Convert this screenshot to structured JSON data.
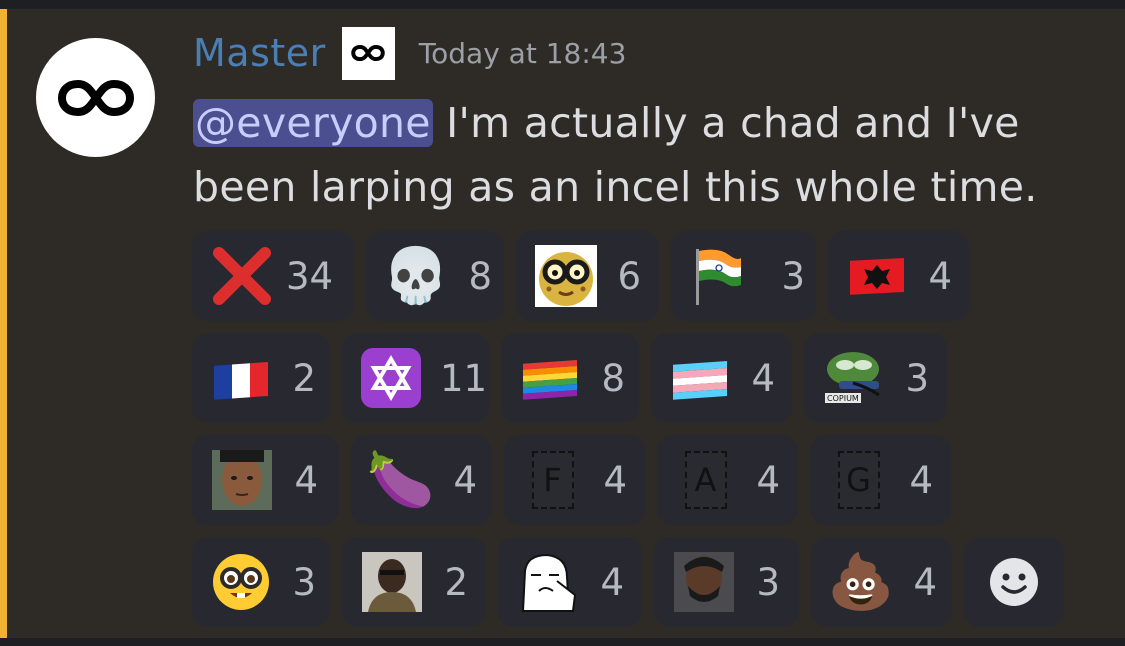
{
  "message": {
    "author": "Master",
    "timestamp": "Today at 18:43",
    "mention": "@everyone",
    "text": " I'm actually a chad and I've been larping as an incel this whole time.",
    "colors": {
      "highlight": "#f0b232",
      "username": "#4a7fb5",
      "mention_bg": "#4b4f8f"
    }
  },
  "reactions": [
    [
      {
        "name": "reaction-cross-mark",
        "emoji": "❌",
        "count": "34"
      },
      {
        "name": "reaction-skull",
        "emoji": "💀",
        "count": "8"
      },
      {
        "name": "reaction-nerd-cookie",
        "emoji": "🤓",
        "count": "6"
      },
      {
        "name": "reaction-flag-india",
        "emoji": "🇮🇳",
        "count": "3"
      },
      {
        "name": "reaction-flag-albania",
        "emoji": "🇦🇱",
        "count": "4"
      }
    ],
    [
      {
        "name": "reaction-flag-france",
        "emoji": "🇫🇷",
        "count": "2"
      },
      {
        "name": "reaction-star-of-david",
        "emoji": "✡",
        "count": "11"
      },
      {
        "name": "reaction-rainbow-flag",
        "emoji": "🏳️‍🌈",
        "count": "8"
      },
      {
        "name": "reaction-trans-flag",
        "emoji": "🏳️‍⚧️",
        "count": "4"
      },
      {
        "name": "reaction-copium-pepe",
        "emoji": "🐸",
        "count": "3"
      }
    ],
    [
      {
        "name": "reaction-face-photo",
        "emoji": "👤",
        "count": "4"
      },
      {
        "name": "reaction-eggplant",
        "emoji": "🍆",
        "count": "4"
      },
      {
        "name": "reaction-letter-f",
        "emoji": "F",
        "count": "4"
      },
      {
        "name": "reaction-letter-a",
        "emoji": "A",
        "count": "4"
      },
      {
        "name": "reaction-letter-g",
        "emoji": "G",
        "count": "4"
      }
    ],
    [
      {
        "name": "reaction-nerd-face",
        "emoji": "🤓",
        "count": "3"
      },
      {
        "name": "reaction-man-photo",
        "emoji": "👤",
        "count": "2"
      },
      {
        "name": "reaction-wojak-crying",
        "emoji": "😭",
        "count": "4"
      },
      {
        "name": "reaction-bearded-photo",
        "emoji": "👤",
        "count": "3"
      },
      {
        "name": "reaction-poop",
        "emoji": "💩",
        "count": "4"
      }
    ]
  ],
  "add_reaction_icon": "smiley-add-reaction-icon"
}
